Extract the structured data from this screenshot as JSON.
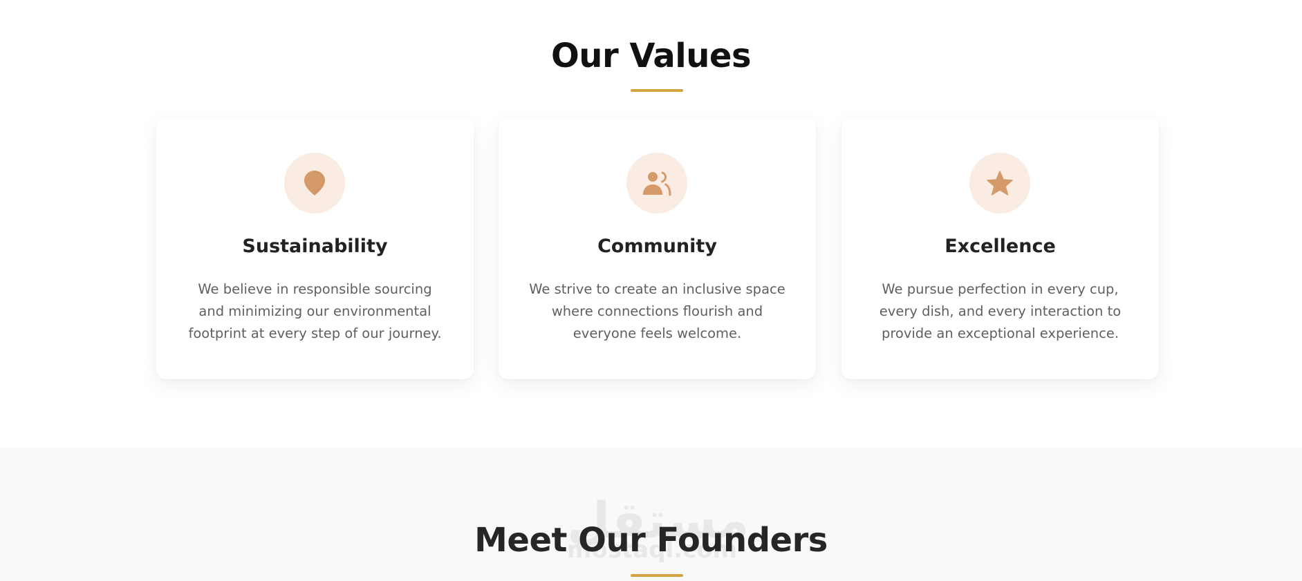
{
  "values": {
    "title": "Our Values",
    "accent_color": "#d3a43f",
    "icon_color": "#d49a6a",
    "icon_bg_color": "#faece2",
    "cards": [
      {
        "icon": "map-pin-icon",
        "title": "Sustainability",
        "text": "We believe in responsible sourcing and minimizing our environmental footprint at every step of our journey."
      },
      {
        "icon": "users-icon",
        "title": "Community",
        "text": "We strive to create an inclusive space where connections flourish and everyone feels welcome."
      },
      {
        "icon": "star-icon",
        "title": "Excellence",
        "text": "We pursue perfection in every cup, every dish, and every interaction to provide an exceptional experience."
      }
    ]
  },
  "founders": {
    "title": "Meet Our Founders"
  },
  "watermark": {
    "arabic": "مستقل",
    "latin": "mostaql.com"
  }
}
